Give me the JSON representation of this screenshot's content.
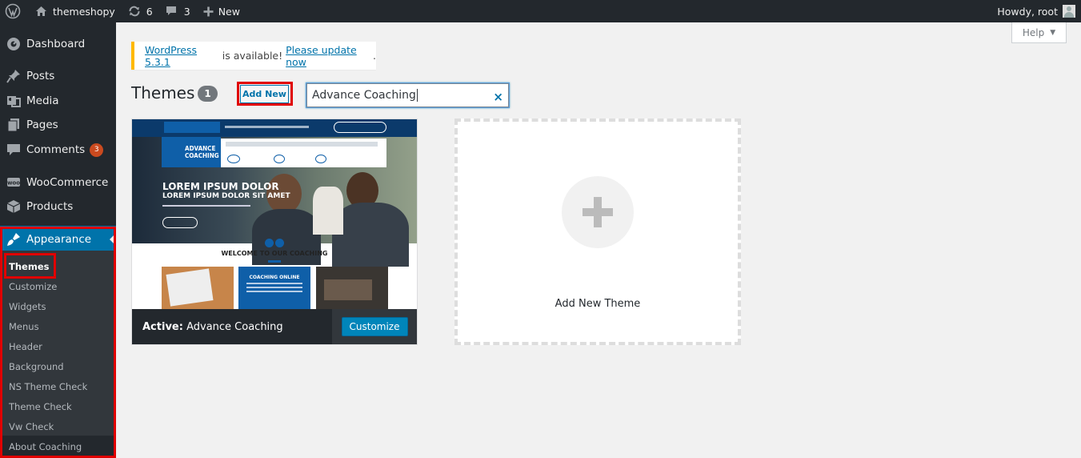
{
  "adminbar": {
    "site_name": "themeshopy",
    "updates_count": "6",
    "comments_count": "3",
    "new_label": "New",
    "greeting": "Howdy, root"
  },
  "sidebar": {
    "items": [
      {
        "label": "Dashboard",
        "icon": "dashboard-icon"
      },
      {
        "label": "Posts",
        "icon": "pin-icon"
      },
      {
        "label": "Media",
        "icon": "media-icon"
      },
      {
        "label": "Pages",
        "icon": "pages-icon"
      },
      {
        "label": "Comments",
        "icon": "comment-icon",
        "badge": "3"
      },
      {
        "label": "WooCommerce",
        "icon": "woo-icon"
      },
      {
        "label": "Products",
        "icon": "box-icon"
      },
      {
        "label": "Appearance",
        "icon": "brush-icon"
      }
    ],
    "submenu": [
      "Themes",
      "Customize",
      "Widgets",
      "Menus",
      "Header",
      "Background",
      "NS Theme Check",
      "Theme Check",
      "Vw Check",
      "About Coaching"
    ]
  },
  "help": {
    "label": "Help",
    "caret": "▼"
  },
  "notice": {
    "link1": "WordPress 5.3.1",
    "middle": " is available! ",
    "link2": "Please update now",
    "end": "."
  },
  "page": {
    "title": "Themes",
    "count": "1",
    "add_new": "Add New",
    "search_value": "Advance Coaching",
    "search_clear": "×"
  },
  "theme": {
    "active_prefix": "Active:",
    "active_name": "Advance Coaching",
    "customize_label": "Customize",
    "screenshot": {
      "logo_text_1": "ADVANCE",
      "logo_text_2": "COACHING",
      "hero_line_1": "LOREM IPSUM DOLOR",
      "hero_line_2": "LOREM IPSUM DOLOR SIT AMET",
      "welcome": "WELCOME TO OUR COACHING",
      "card_title": "COACHING ONLINE"
    }
  },
  "add_theme": {
    "label": "Add New Theme"
  },
  "colors": {
    "admin_dark": "#23282d",
    "wp_blue": "#0073aa",
    "highlight_red": "#e00000",
    "notice_yellow": "#ffb900"
  }
}
